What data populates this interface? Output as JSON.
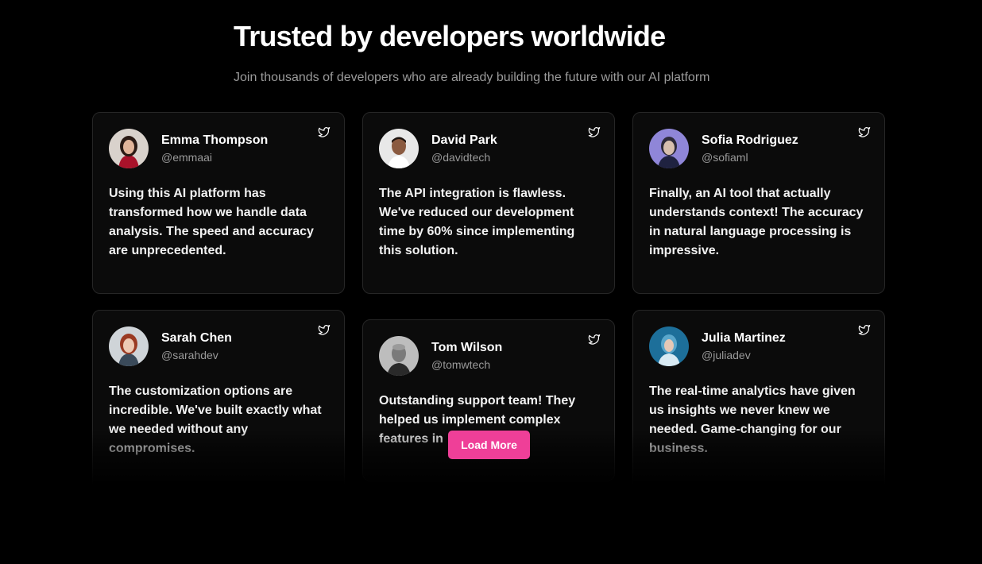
{
  "section": {
    "title": "Trusted by developers worldwide",
    "subtitle": "Join thousands of developers who are already building the future with our AI platform"
  },
  "testimonials": [
    {
      "name": "Emma Thompson",
      "handle": "@emmaai",
      "text": "Using this AI platform has transformed how we handle data analysis. The speed and accuracy are unprecedented.",
      "icon": "twitter-icon"
    },
    {
      "name": "David Park",
      "handle": "@davidtech",
      "text": "The API integration is flawless. We've reduced our development time by 60% since implementing this solution.",
      "icon": "twitter-icon"
    },
    {
      "name": "Sofia Rodriguez",
      "handle": "@sofiaml",
      "text": "Finally, an AI tool that actually understands context! The accuracy in natural language processing is impressive.",
      "icon": "twitter-icon"
    },
    {
      "name": "Sarah Chen",
      "handle": "@sarahdev",
      "text": "The customization options are incredible. We've built exactly what we needed without any compromises.",
      "icon": "twitter-icon"
    },
    {
      "name": "Tom Wilson",
      "handle": "@tomwtech",
      "text": "Outstanding support team! They helped us implement complex features in",
      "icon": "twitter-icon"
    },
    {
      "name": "Julia Martinez",
      "handle": "@juliadev",
      "text": "The real-time analytics have given us insights we never knew we needed. Game-changing for our business.",
      "icon": "twitter-icon"
    }
  ],
  "load_more_label": "Load More",
  "colors": {
    "background": "#000000",
    "card": "#0b0b0b",
    "card_border": "#262626",
    "accent": "#ef3f98",
    "muted_text": "#9a9a9a"
  }
}
